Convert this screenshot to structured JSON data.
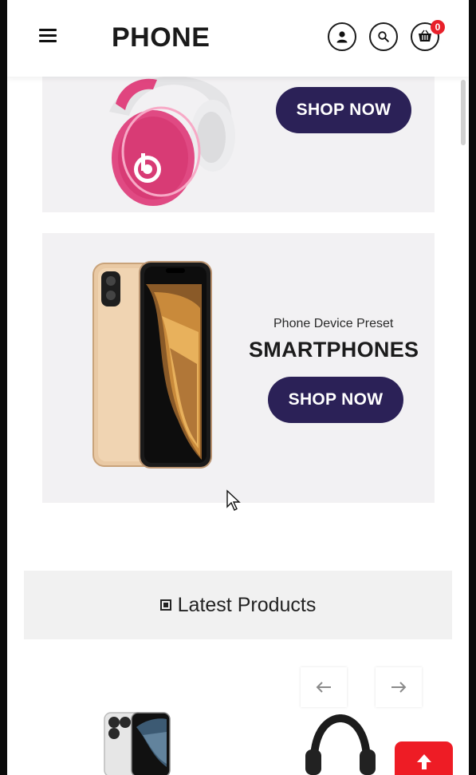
{
  "header": {
    "brand": "PHONE",
    "icons": [
      "menu-icon",
      "user-icon",
      "search-icon",
      "cart-icon"
    ],
    "cart_count": "0"
  },
  "banners": [
    {
      "image": "headphones-icon",
      "button_label": "SHOP NOW"
    },
    {
      "image": "smartphone-icon",
      "subtitle": "Phone Device Preset",
      "title": "SMARTPHONES",
      "button_label": "SHOP NOW"
    }
  ],
  "latest": {
    "title": "Latest Products",
    "prev_icon": "arrow-left-icon",
    "next_icon": "arrow-right-icon"
  },
  "colors": {
    "button": "#2b2157",
    "badge": "#e8202a",
    "scroll_top": "#ee1c25",
    "banner_bg": "#f2f1f3"
  },
  "scroll_top_icon": "arrow-up-icon"
}
